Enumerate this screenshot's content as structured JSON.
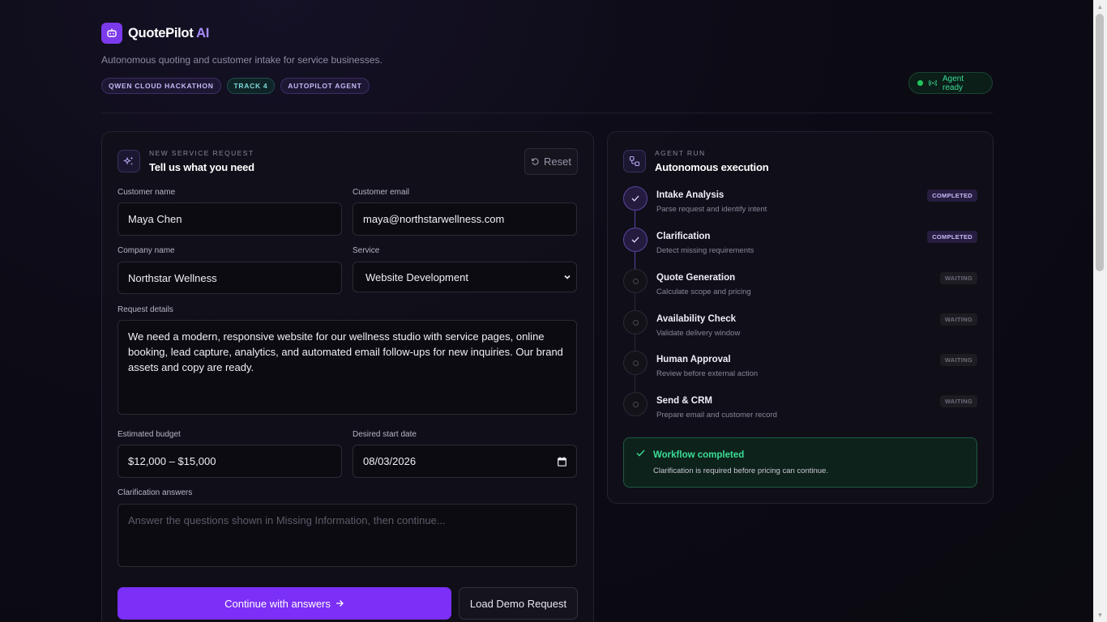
{
  "app": {
    "brand_name": "QuotePilot",
    "brand_suffix": "AI",
    "tagline": "Autonomous quoting and customer intake for service businesses.",
    "logo_icon": "robot-icon",
    "accent_color": "#7b2ff7"
  },
  "badges": [
    "QWEN CLOUD HACKATHON",
    "TRACK 4",
    "AUTOPILOT AGENT"
  ],
  "agent_status": {
    "label": "Agent ready",
    "color": "#22c55e"
  },
  "intake": {
    "eyebrow": "NEW SERVICE REQUEST",
    "title": "Tell us what you need",
    "reset_label": "Reset",
    "customer_name": {
      "label": "Customer name",
      "value": "Maya Chen"
    },
    "customer_email": {
      "label": "Customer email",
      "value": "maya@northstarwellness.com"
    },
    "company_name": {
      "label": "Company name",
      "value": "Northstar Wellness"
    },
    "service": {
      "label": "Service",
      "value": "Website Development"
    },
    "request_details": {
      "label": "Request details",
      "value": "We need a modern, responsive website for our wellness studio with service pages, online booking, lead capture, analytics, and automated email follow-ups for new inquiries. Our brand assets and copy are ready."
    },
    "budget": {
      "label": "Estimated budget",
      "value": "$12,000 – $15,000"
    },
    "start_date": {
      "label": "Desired start date",
      "value": "08/03/2026"
    },
    "clarification": {
      "label": "Clarification answers",
      "placeholder": "Answer the questions shown in Missing Information, then continue..."
    },
    "continue_label": "Continue with answers",
    "demo_label": "Load Demo Request"
  },
  "agent_run": {
    "eyebrow": "AGENT RUN",
    "title": "Autonomous execution",
    "steps": [
      {
        "name": "Intake Analysis",
        "desc": "Parse request and identify intent",
        "status": "COMPLETED"
      },
      {
        "name": "Clarification",
        "desc": "Detect missing requirements",
        "status": "COMPLETED"
      },
      {
        "name": "Quote Generation",
        "desc": "Calculate scope and pricing",
        "status": "WAITING"
      },
      {
        "name": "Availability Check",
        "desc": "Validate delivery window",
        "status": "WAITING"
      },
      {
        "name": "Human Approval",
        "desc": "Review before external action",
        "status": "WAITING"
      },
      {
        "name": "Send & CRM",
        "desc": "Prepare email and customer record",
        "status": "WAITING"
      }
    ],
    "result": {
      "title": "Workflow completed",
      "message": "Clarification is required before pricing can continue."
    }
  }
}
